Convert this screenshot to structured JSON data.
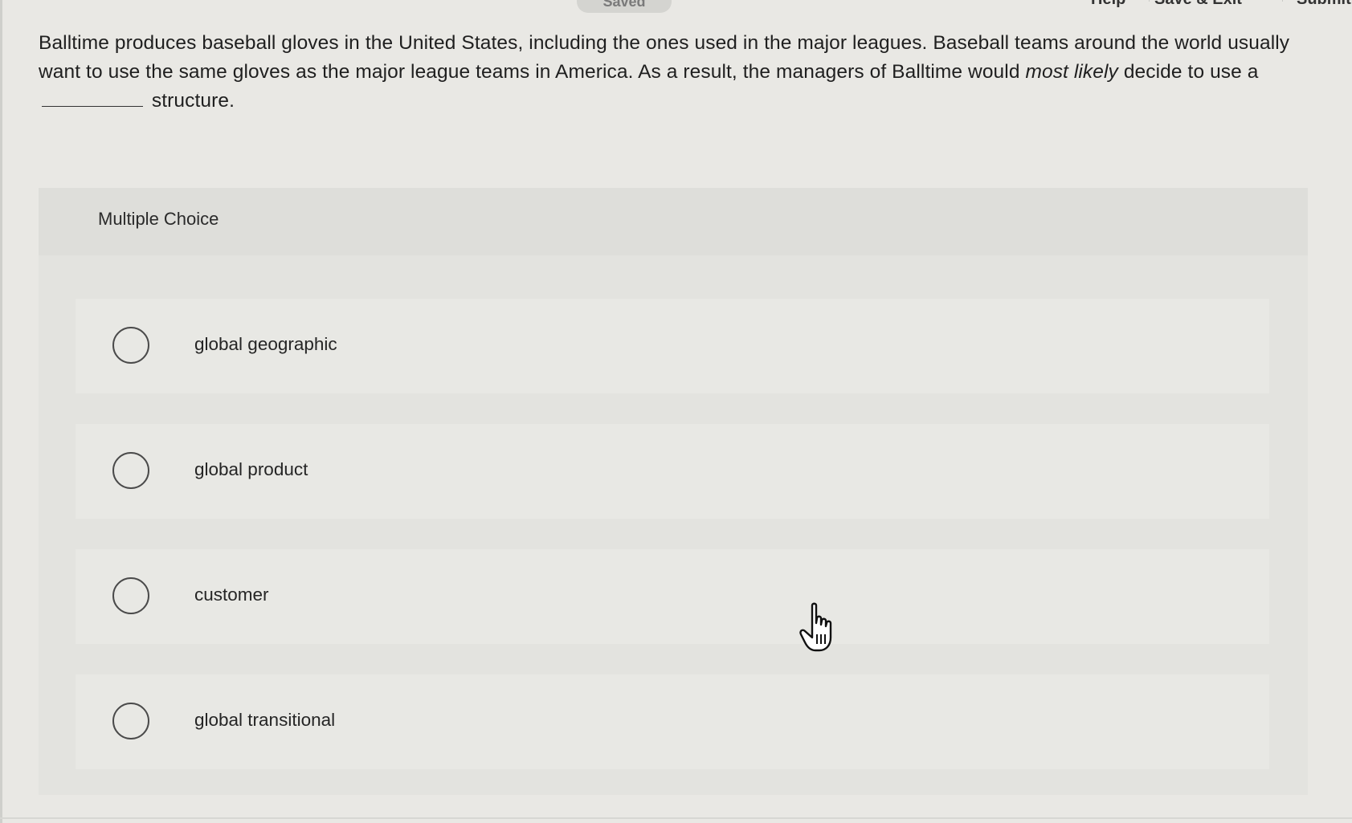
{
  "top_nav": {
    "saved_label": "Saved",
    "help_label": "Help",
    "save_exit_label": "Save & Exit",
    "submit_label": "Submit"
  },
  "question": {
    "text_part1": "Balltime produces baseball gloves in the United States, including the ones used in the major leagues. Baseball teams around the world usually want to use the same gloves as the major league teams in America. As a result, the managers of Balltime would ",
    "emphasis_1": "most likely",
    "text_part2": " decide to use a ",
    "text_part3": " structure."
  },
  "multiple_choice": {
    "label": "Multiple Choice",
    "options": [
      {
        "label": "global geographic"
      },
      {
        "label": "global product"
      },
      {
        "label": "customer"
      },
      {
        "label": "global transitional"
      }
    ]
  },
  "icons": {
    "radio": "radio-unselected-icon",
    "cursor": "hand-pointer-icon"
  },
  "colors": {
    "background": "#e9e8e4",
    "panel": "#e3e3df",
    "text": "#1f1f1f"
  }
}
